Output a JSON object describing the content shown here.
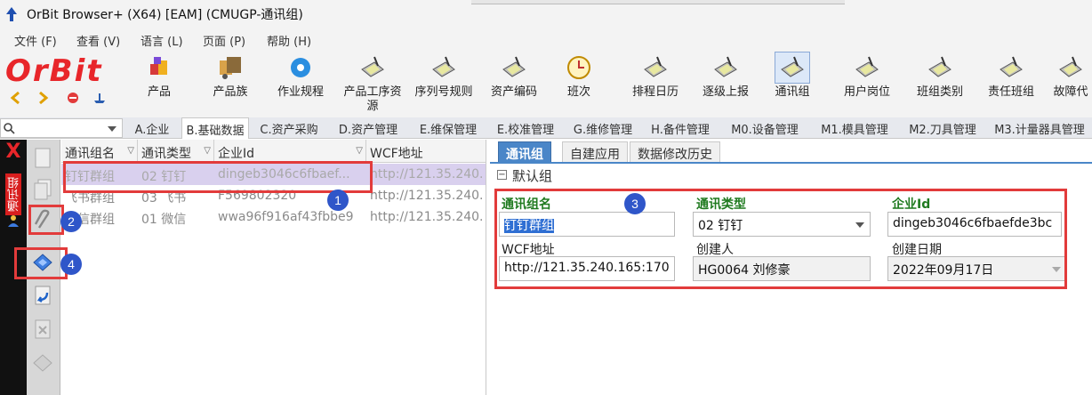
{
  "window": {
    "title": "OrBit Browser+ (X64) [EAM] (CMUGP-通讯组)"
  },
  "menu": [
    "文件 (F)",
    "查看 (V)",
    "语言 (L)",
    "页面 (P)",
    "帮助 (H)"
  ],
  "brand": {
    "logo_text": "OrBit"
  },
  "toolbar": [
    {
      "label": "产品",
      "icon": "product-icon"
    },
    {
      "label": "产品族",
      "icon": "product-family-icon"
    },
    {
      "label": "作业规程",
      "icon": "gear-icon"
    },
    {
      "label": "产品工序资源",
      "icon": "clipboard-icon"
    },
    {
      "label": "序列号规则",
      "icon": "clipboard-icon"
    },
    {
      "label": "资产编码",
      "icon": "clipboard-icon"
    },
    {
      "label": "班次",
      "icon": "clock-icon"
    },
    {
      "label": "排程日历",
      "icon": "clipboard-icon"
    },
    {
      "label": "逐级上报",
      "icon": "clipboard-icon"
    },
    {
      "label": "通讯组",
      "icon": "clipboard-icon",
      "active": true
    },
    {
      "label": "用户岗位",
      "icon": "clipboard-icon"
    },
    {
      "label": "班组类别",
      "icon": "clipboard-icon"
    },
    {
      "label": "责任班组",
      "icon": "clipboard-icon"
    },
    {
      "label": "故障代",
      "icon": "clipboard-icon"
    }
  ],
  "search": {
    "placeholder": ""
  },
  "module_tabs": [
    {
      "label": "A.企业"
    },
    {
      "label": "B.基础数据",
      "active": true
    },
    {
      "label": "C.资产采购"
    },
    {
      "label": "D.资产管理"
    },
    {
      "label": "E.维保管理"
    },
    {
      "label": "E.校准管理"
    },
    {
      "label": "G.维修管理"
    },
    {
      "label": "H.备件管理"
    },
    {
      "label": "M0.设备管理"
    },
    {
      "label": "M1.模具管理"
    },
    {
      "label": "M2.刀具管理"
    },
    {
      "label": "M3.计量器具管理"
    }
  ],
  "side_panel": {
    "label": "通讯组",
    "close": "X"
  },
  "grid": {
    "columns": [
      "通讯组名",
      "通讯类型",
      "企业Id",
      "WCF地址"
    ],
    "rows": [
      [
        "钉钉群组",
        "02 钉钉",
        "dingeb3046c6fbaef...",
        "http://121.35.240."
      ],
      [
        "飞书群组",
        "03 飞书",
        "F569802320",
        "http://121.35.240."
      ],
      [
        "微信群组",
        "01 微信",
        "wwa96f916af43fbbe9",
        "http://121.35.240."
      ]
    ],
    "selected_row": 0
  },
  "detail": {
    "tabs": [
      "通讯组",
      "自建应用",
      "数据修改历史"
    ],
    "active_tab": 0,
    "group_title": "默认组",
    "fields": {
      "group_name": {
        "label": "通讯组名",
        "value": "钉钉群组"
      },
      "comm_type": {
        "label": "通讯类型",
        "value": "02 钉钉"
      },
      "enterprise_id": {
        "label": "企业Id",
        "value": "dingeb3046c6fbaefde3bc"
      },
      "wcf_address": {
        "label": "WCF地址",
        "value": "http://121.35.240.165:170"
      },
      "creator": {
        "label": "创建人",
        "value": "HG0064 刘修豪"
      },
      "created_date": {
        "label": "创建日期",
        "value": "2022年09月17日"
      }
    }
  },
  "annotations": [
    "1",
    "2",
    "3",
    "4"
  ],
  "colors": {
    "accent": "#4a86c8",
    "annotation": "#e23b3b",
    "badge": "#2f56c9",
    "brand": "#e8262a"
  }
}
